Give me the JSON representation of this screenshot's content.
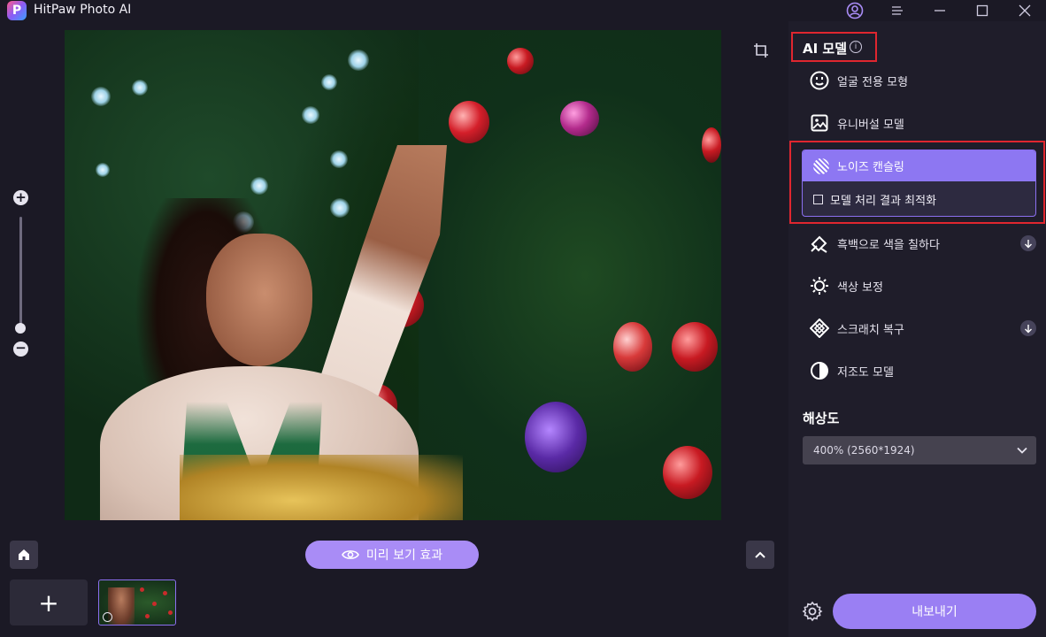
{
  "app": {
    "title": "HitPaw Photo AI",
    "logo_letter": "P"
  },
  "titlebar": {
    "icons": [
      "account-icon",
      "menu-icon",
      "minimize-icon",
      "maximize-icon",
      "close-icon"
    ]
  },
  "canvas": {
    "zoom_in_symbol": "+",
    "zoom_out_symbol": "−",
    "zoom_level": 0.05
  },
  "bottom": {
    "preview_label": "미리 보기 효과",
    "add_symbol": "+"
  },
  "panel": {
    "model_title": "AI 모델",
    "info_symbol": "i",
    "models": [
      {
        "label": "얼굴 전용 모형",
        "icon": "face-icon"
      },
      {
        "label": "유니버설 모델",
        "icon": "image-icon"
      },
      {
        "label": "노이즈 캔슬링",
        "icon": "denoise-icon",
        "selected": true
      },
      {
        "label": "흑백으로 색을 칠하다",
        "icon": "colorize-icon",
        "downloadable": true
      },
      {
        "label": "색상 보정",
        "icon": "brightness-icon"
      },
      {
        "label": "스크래치 복구",
        "icon": "scratch-repair-icon",
        "downloadable": true
      },
      {
        "label": "저조도 모델",
        "icon": "contrast-icon"
      }
    ],
    "optimize_option": {
      "label": "모델 처리 결과 최적화",
      "checked": false
    },
    "resolution_title": "해상도",
    "resolution_value": "400% (2560*1924)",
    "export_label": "내보내기"
  },
  "colors": {
    "accent": "#9a7ff3",
    "highlight_red": "#e0262f",
    "panel_bg": "#1f1d2a"
  }
}
